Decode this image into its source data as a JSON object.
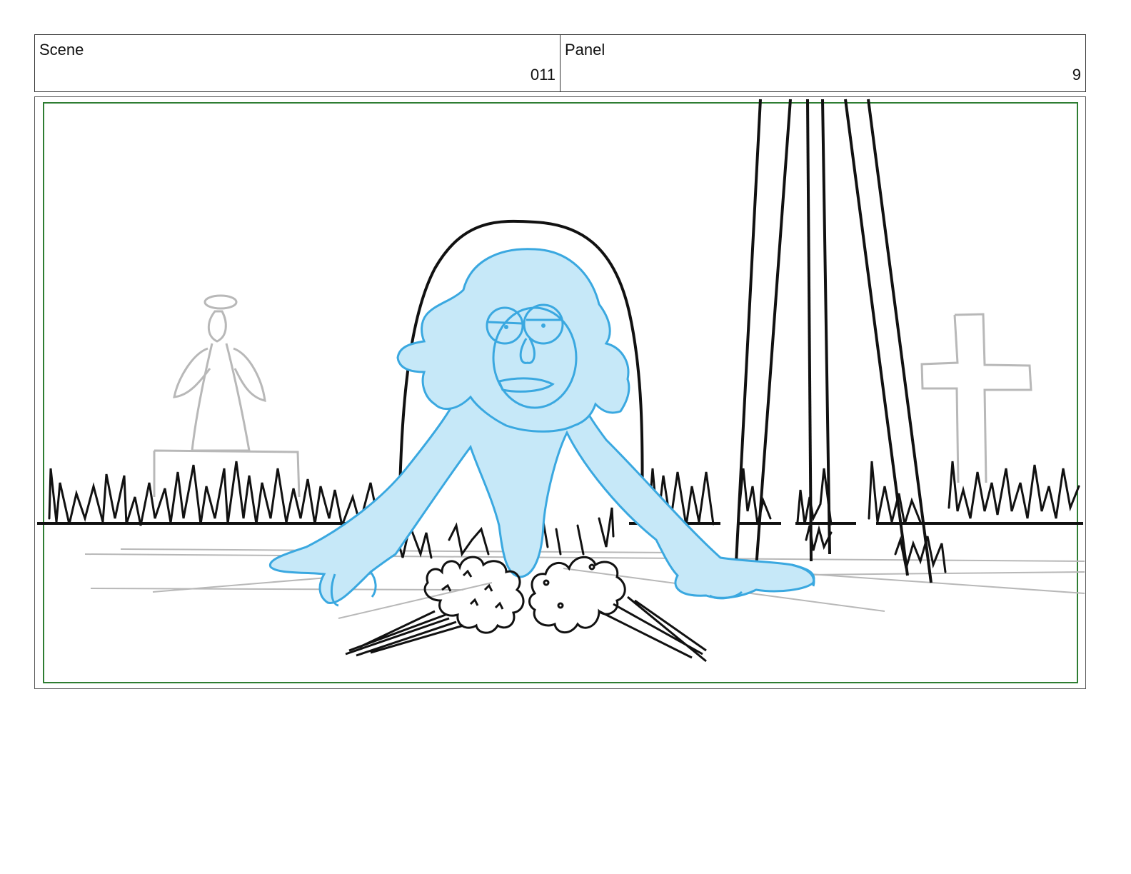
{
  "header": {
    "scene_label": "Scene",
    "scene_value": "011",
    "panel_label": "Panel",
    "panel_value": "9"
  },
  "colors": {
    "safe_frame": "#2e7d32",
    "ghost_fill": "#c6e8f8",
    "ghost_line": "#3aa8e0",
    "ink": "#111111",
    "background_sketch": "#b8b8b8"
  }
}
